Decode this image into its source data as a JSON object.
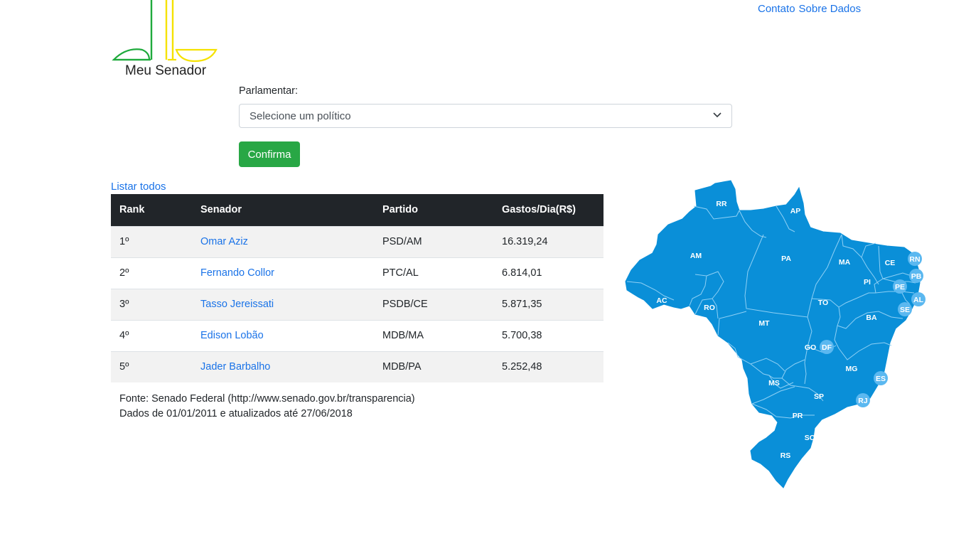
{
  "nav": {
    "contact_label": "Contato",
    "about_label": "Sobre Dados"
  },
  "brand": {
    "name": "Meu Senador"
  },
  "form": {
    "label": "Parlamentar:",
    "select_value": "Selecione um político",
    "confirm_label": "Confirma"
  },
  "list_all_label": "Listar todos",
  "table": {
    "headers": [
      "Rank",
      "Senador",
      "Partido",
      "Gastos/Dia(R$)"
    ],
    "rows": [
      {
        "rank": "1º",
        "senator": "Omar Aziz",
        "party": "PSD/AM",
        "spend": "16.319,24"
      },
      {
        "rank": "2º",
        "senator": "Fernando Collor",
        "party": "PTC/AL",
        "spend": "6.814,01"
      },
      {
        "rank": "3º",
        "senator": "Tasso Jereissati",
        "party": "PSDB/CE",
        "spend": "5.871,35"
      },
      {
        "rank": "4º",
        "senator": "Edison Lobão",
        "party": "MDB/MA",
        "spend": "5.700,38"
      },
      {
        "rank": "5º",
        "senator": "Jader Barbalho",
        "party": "MDB/PA",
        "spend": "5.252,48"
      }
    ]
  },
  "source": {
    "line1": "Fonte: Senado Federal (http://www.senado.gov.br/transparencia)",
    "line2": "Dados de 01/01/2011 e atualizados até 27/06/2018"
  },
  "map": {
    "fill_color": "#0a8fd8",
    "badge_color": "#5bb8f0",
    "states": [
      "RR",
      "AP",
      "AM",
      "PA",
      "MA",
      "CE",
      "RN",
      "PB",
      "PE",
      "AL",
      "SE",
      "PI",
      "AC",
      "RO",
      "TO",
      "BA",
      "MT",
      "GO",
      "DF",
      "MG",
      "ES",
      "MS",
      "SP",
      "RJ",
      "PR",
      "SC",
      "RS"
    ]
  },
  "colors": {
    "link": "#1a73e8",
    "confirm_button": "#28a745",
    "table_header": "#212529"
  }
}
